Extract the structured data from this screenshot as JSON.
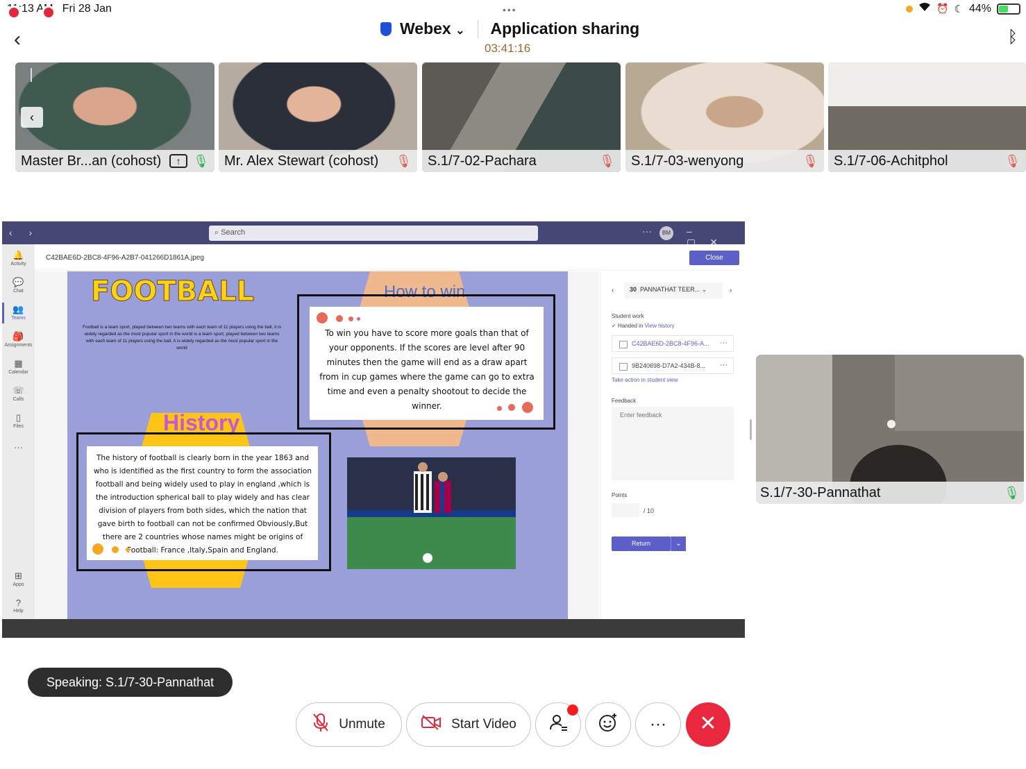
{
  "status_bar": {
    "time": "11:13 AM",
    "date": "Fri 28 Jan",
    "battery": "44%",
    "more": "•••"
  },
  "header": {
    "app": "Webex",
    "title": "Application sharing",
    "timer": "03:41:16",
    "back_glyph": "‹",
    "bluetooth_glyph": "ᛒ"
  },
  "participants": [
    {
      "name": "Master Br...an (cohost)",
      "muted": false,
      "sharing": true
    },
    {
      "name": "Mr. Alex Stewart (cohost)",
      "muted": true
    },
    {
      "name": "S.1/7-02-Pachara",
      "muted": true
    },
    {
      "name": "S.1/7-03-wenyong",
      "muted": true
    },
    {
      "name": "S.1/7-06-Achitphol",
      "muted": true
    }
  ],
  "teams": {
    "search_placeholder": "Search",
    "avatar": "BM",
    "file_name": "C42BAE6D-2BC8-4F96-A2B7-041266D1861A.jpeg",
    "close_label": "Close",
    "rail": [
      {
        "label": "Activity",
        "glyph": "🔔"
      },
      {
        "label": "Chat",
        "glyph": "💬"
      },
      {
        "label": "Teams",
        "glyph": "👥"
      },
      {
        "label": "Assignments",
        "glyph": "🎒"
      },
      {
        "label": "Calendar",
        "glyph": "▦"
      },
      {
        "label": "Calls",
        "glyph": "☏"
      },
      {
        "label": "Files",
        "glyph": "▯"
      },
      {
        "label": "",
        "glyph": "···"
      },
      {
        "label": "Apps",
        "glyph": "⊞"
      },
      {
        "label": "Help",
        "glyph": "?"
      }
    ],
    "panel": {
      "student_num": "30",
      "student_name": "PANNATHAT TEER...",
      "student_work_label": "Student work",
      "handed_in": "Handed in",
      "view_history": "View history",
      "files": [
        "C42BAE6D-2BC8-4F96-A...",
        "9B240698-D7A2-434B-8..."
      ],
      "take_action": "Take action in student view",
      "feedback_label": "Feedback",
      "feedback_placeholder": "Enter feedback",
      "points_label": "Points",
      "points_max": "/ 10",
      "return_label": "Return"
    }
  },
  "slide": {
    "title": "FOOTBALL",
    "intro": "Football is a team sport, played between two teams with each team of 11 players using the ball, it is widely regarded as the most popular sport in the world is a team sport, played between two teams with each team of 11 players using the ball, it is widely regarded as the most popular sport in the world",
    "howto_title": "How to win",
    "howto_text": "To win you have to score more goals than that of your opponents. If the scores are level after 90 minutes then the game will end as a draw apart from in cup games where the game can go to extra time and even a penalty shootout to decide the winner.",
    "history_title": "History",
    "history_text": "The history of football is clearly born in the year 1863 and who is identified as the first country to form the association football and being widely used to play in england ,which is the introduction spherical ball to play widely and has clear division of players from both sides, which the nation that gave birth to football can not be confirmed Obviously,But there are 2 countries whose names might be origins of Football: France ,Italy,Spain and England."
  },
  "self_view": {
    "name": "S.1/7-30-Pannathat"
  },
  "speaking": "Speaking: S.1/7-30-Pannathat",
  "controls": {
    "unmute": "Unmute",
    "start_video": "Start Video",
    "more": "···",
    "end": "✕"
  },
  "colors": {
    "teams_purple": "#464775",
    "accent": "#5b5fc7",
    "end_red": "#e8283e",
    "slide_bg": "#9a9fd9"
  }
}
